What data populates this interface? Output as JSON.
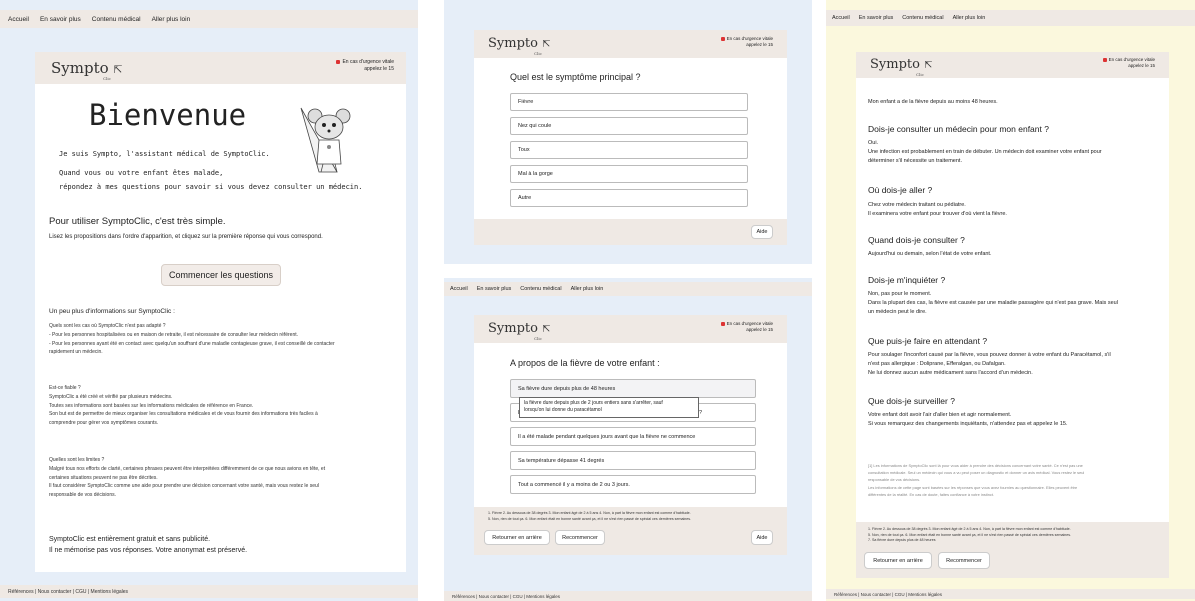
{
  "nav": {
    "home": "Accueil",
    "more": "En savoir plus",
    "medical": "Contenu médical",
    "further": "Aller plus loin"
  },
  "footer": {
    "links": "Références | Nous contacter | CGU | Mentions légales"
  },
  "logo": {
    "main": "Sympto",
    "sub": "Clic"
  },
  "urgence": {
    "line1": "En cas d'urgence vitale",
    "line2": "appelez le 15"
  },
  "colors": {
    "left_bg": "#e6eef8",
    "middle_top_bg": "#e6eef8",
    "middle_bottom_bg": "#e6eef8",
    "right_bg": "#fbf8dd",
    "beige": "#efe9e4"
  },
  "welcome": {
    "title": "Bienvenue",
    "intro": "Je suis Sympto, l'assistant médical de SymptoClic.",
    "line2": "Quand vous ou votre enfant êtes malade,",
    "line3": "répondez à mes questions pour savoir si vous devez consulter un médecin.",
    "howto_title": "Pour utiliser SymptoClic, c'est très simple.",
    "howto_text": "Lisez les propositions dans l'ordre d'apparition, et cliquez sur la première réponse qui vous correspond.",
    "start_button": "Commencer les questions",
    "info_title": "Un peu plus d'informations sur SymptoClic :",
    "q1": "Quels sont les cas où SymptoClic n'est pas adapté ?",
    "a1_1": "- Pour les personnes hospitalisées ou en maison de retraite, il est nécessaire de consulter leur médecin référent.",
    "a1_2": "- Pour les personnes ayant été en contact avec quelqu'un souffrant d'une maladie contagieuse grave, il est conseillé de contacter",
    "a1_3": "rapidement un médecin.",
    "q2": "Est-ce fiable ?",
    "a2_1": "SymptoClic a été créé et vérifié par plusieurs médecins.",
    "a2_2": "Toutes ses informations sont basées sur les informations médicales de référence en France.",
    "a2_3": "Son but est de permettre de mieux organiser les consultations médicales et de vous fournir des informations très faciles à",
    "a2_4": "comprendre pour gérer vos symptômes courants.",
    "q3": "Quelles sont les limites ?",
    "a3_1": "Malgré tous nos efforts de clarté, certaines phrases peuvent être interprétées différemment de ce que nous avions en tête, et",
    "a3_2": "certaines situations peuvent ne pas être décrites.",
    "a3_3": "Il faut considérer SymptoClic comme une aide pour prendre une décision concernant votre santé, mais vous restez le seul",
    "a3_4": "responsable de vos décisions.",
    "free1": "SymptoClic est entièrement gratuit et sans publicité.",
    "free2": "Il ne mémorise pas vos réponses. Votre anonymat est préservé."
  },
  "symptom": {
    "question": "Quel est le symptôme principal ?",
    "options": [
      "Fièvre",
      "Nez qui coule",
      "Toux",
      "Mal à la gorge",
      "Autre"
    ],
    "help": "Aide"
  },
  "fever": {
    "question": "A propos de la fièvre de votre enfant :",
    "options": [
      "Sa fièvre dure depuis plus de 48 heures",
      "L",
      "Il a été malade pendant quelques jours avant que la fièvre ne commence",
      "Sa température dépasse 41 degrés",
      "Tout a commencé il y a moins de 2 ou 3 jours."
    ],
    "option2_tail": "?",
    "tooltip1": "la fièvre dure depuis plus de 2 jours entiers sans s'arrêter, sauf",
    "tooltip2": "lorsqu'on lui donne du paracétamol",
    "history1": "1. Fièvre   2. Au dessous de 38 degrés   3. Mon enfant âgé de 2 à 5 ans   4. Non, à part la fièvre mon enfant est comme d'habitude.",
    "history2": "5. Non, rien de tout ça.   6. Mon enfant était en bonne santé avant ça, et il ne s'est rien passé de spécial ces dernières semaines.",
    "back": "Retourner en arrière",
    "restart": "Recommencer",
    "help": "Aide"
  },
  "result": {
    "intro": "Mon enfant a de la fièvre depuis au moins 48 heures.",
    "s1_title": "Dois-je consulter un médecin pour mon enfant ?",
    "s1_1": "Oui.",
    "s1_2": "Une infection est probablement en train de débuter. Un médecin doit examiner votre enfant pour",
    "s1_3": "déterminer s'il nécessite un traitement.",
    "s2_title": "Où dois-je aller ?",
    "s2_1": "Chez votre médecin traitant ou pédiatre.",
    "s2_2": "Il examinera votre enfant pour trouver d'où vient la fièvre.",
    "s3_title": "Quand dois-je consulter ?",
    "s3_1": "Aujourd'hui ou demain, selon l'état de votre enfant.",
    "s4_title": "Dois-je m'inquiéter ?",
    "s4_1": "Non, pas pour le moment.",
    "s4_2": "Dans la plupart des cas, la fièvre est causée par une maladie passagère qui n'est pas grave. Mais seul",
    "s4_3": "un médecin peut le dire.",
    "s5_title": "Que puis-je faire en attendant ?",
    "s5_1": "Pour soulager l'inconfort causé par la fièvre, vous pouvez donner à votre enfant du Paracétamol, s'il",
    "s5_2": "n'est pas allergique : Doliprane, Efferalgan, ou Dafalgan.",
    "s5_3": "Ne lui donnez aucun autre médicament sans l'accord d'un médecin.",
    "s6_title": "Que dois-je surveiller ?",
    "s6_1": "Votre enfant doit avoir l'air d'aller bien et agir normalement.",
    "s6_2": "Si vous remarquez des changements inquiétants, n'attendez pas et appelez le 15.",
    "disc1": "[1] Les informations de SymptoClic sont là pour vous aider à prendre des décisions concernant votre santé. Ce n'est pas une",
    "disc2": "consultation médicale. Seul un médecin qui vous a vu peut poser un diagnostic et donner un avis médical. Vous restez le seul",
    "disc3": "responsable de vos décisions.",
    "disc4": "Les informations de cette page sont basées sur les réponses que vous avez fournies au questionnaire. Elles peuvent être",
    "disc5": "différentes de la réalité. En cas de doute, faites confiance à votre instinct.",
    "hist1": "1. Fièvre   2. Au dessous de 38 degrés   3. Mon enfant âgé de 2 à 5 ans   4. Non, à part la fièvre mon enfant est comme d'habitude.",
    "hist2": "5. Non, rien de tout ça.   6. Mon enfant était en bonne santé avant ça, et il ne s'est rien passé de spécial ces dernières semaines.",
    "hist3": "7. Sa fièvre dure depuis plus de 48 heures",
    "back": "Retourner en arrière",
    "restart": "Recommencer"
  }
}
